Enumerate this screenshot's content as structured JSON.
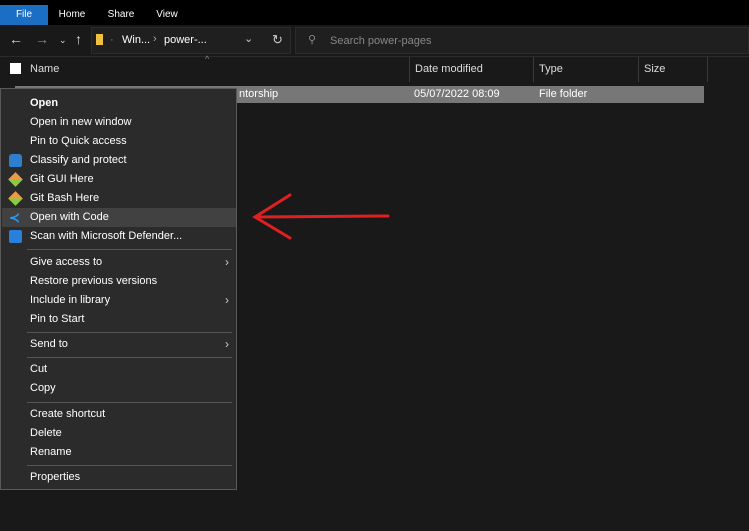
{
  "ribbon": {
    "tabs": [
      "File",
      "Home",
      "Share",
      "View"
    ],
    "accent": "#1a6fc4"
  },
  "nav": {
    "breadcrumb": [
      "Win...",
      "power-..."
    ],
    "search_placeholder": "Search power-pages"
  },
  "columns": [
    "Name",
    "Date modified",
    "Type",
    "Size"
  ],
  "rows": [
    {
      "name": "ntorship",
      "date": "05/07/2022 08:09",
      "type": "File folder",
      "size": ""
    }
  ],
  "menu": {
    "items": [
      {
        "label": "Open",
        "bold": true
      },
      {
        "label": "Open in new window"
      },
      {
        "label": "Pin to Quick access"
      },
      {
        "label": "Classify and protect",
        "icon": "lock-icon"
      },
      {
        "label": "Git GUI Here",
        "icon": "git-icon"
      },
      {
        "label": "Git Bash Here",
        "icon": "git-icon"
      },
      {
        "label": "Open with Code",
        "icon": "vscode-icon",
        "highlighted": true
      },
      {
        "label": "Scan with Microsoft Defender...",
        "icon": "defender-icon"
      },
      {
        "label": "Give access to",
        "submenu": true
      },
      {
        "label": "Restore previous versions"
      },
      {
        "label": "Include in library",
        "submenu": true
      },
      {
        "label": "Pin to Start"
      },
      {
        "label": "Send to",
        "submenu": true
      },
      {
        "label": "Cut"
      },
      {
        "label": "Copy"
      },
      {
        "label": "Create shortcut"
      },
      {
        "label": "Delete"
      },
      {
        "label": "Rename"
      },
      {
        "label": "Properties"
      }
    ]
  },
  "annotation": {
    "arrow_color": "#e02020"
  }
}
